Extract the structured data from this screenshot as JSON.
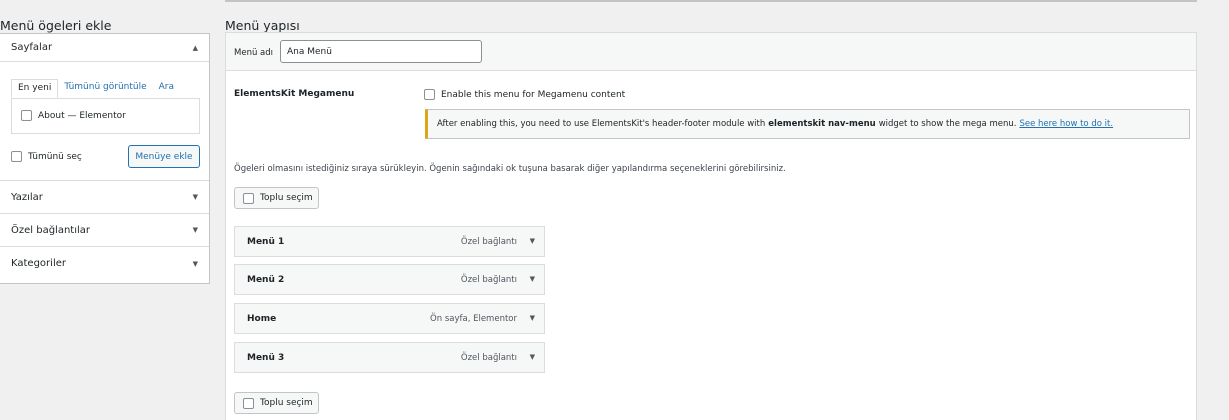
{
  "left": {
    "section_title": "Menü ögeleri ekle",
    "pages": {
      "title": "Sayfalar",
      "tabs": [
        "En yeni",
        "Tümünü görüntüle",
        "Ara"
      ],
      "items": [
        "About — Elementor"
      ],
      "select_all_label": "Tümünü seç",
      "add_button_label": "Menüye ekle"
    },
    "sections": [
      "Yazılar",
      "Özel bağlantılar",
      "Kategoriler"
    ]
  },
  "right": {
    "section_title": "Menü yapısı",
    "menu_name_label": "Menü adı",
    "menu_name_value": "Ana Menü",
    "megamenu": {
      "label": "ElementsKit Megamenu",
      "checkbox_label": "Enable this menu for Megamenu content",
      "notice_prefix": "After enabling this, you need to use ElementsKit's header-footer module with",
      "notice_bold": "elementskit nav-menu",
      "notice_suffix": "widget to show the mega menu.",
      "notice_link": "See here how to do it."
    },
    "instructions": "Ögeleri olmasını istediğiniz sıraya sürükleyin. Ögenin sağındaki ok tuşuna basarak diğer yapılandırma seçeneklerini görebilirsiniz.",
    "bulk_select_label": "Toplu seçim",
    "menu_items": [
      {
        "title": "Menü 1",
        "type": "Özel bağlantı"
      },
      {
        "title": "Menü 2",
        "type": "Özel bağlantı"
      },
      {
        "title": "Home",
        "type": "Ön sayfa, Elementor"
      },
      {
        "title": "Menü 3",
        "type": "Özel bağlantı"
      }
    ]
  },
  "icons": {
    "collapse": "triangle-up-icon",
    "expand": "triangle-down-icon"
  },
  "colors": {
    "accent": "#2271b1",
    "notice_border": "#dba617",
    "background": "#f0f0f1"
  }
}
